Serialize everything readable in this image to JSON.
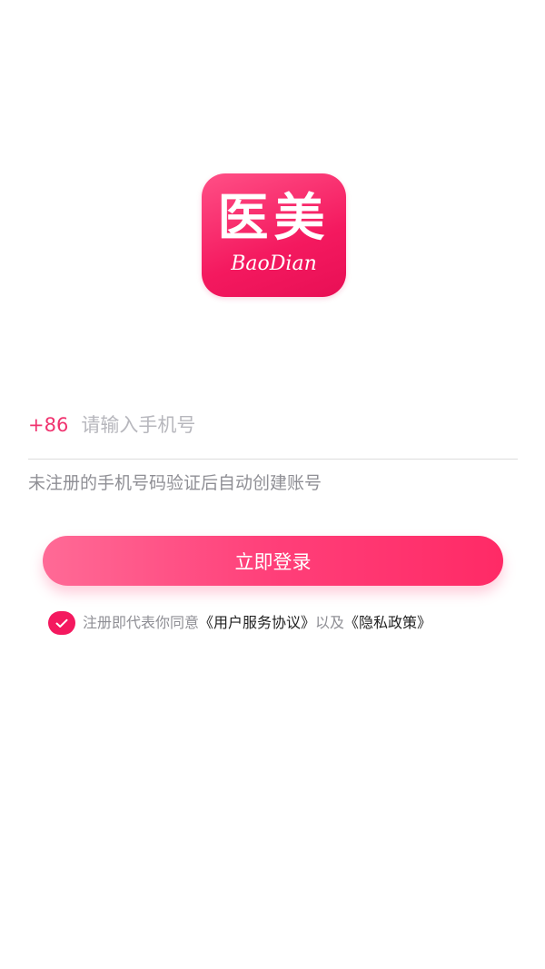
{
  "logo": {
    "main_text": "医美",
    "sub_text": "BaoDian"
  },
  "login": {
    "country_code": "+86",
    "phone_placeholder": "请输入手机号",
    "hint": "未注册的手机号码验证后自动创建账号",
    "button_label": "立即登录"
  },
  "agreement": {
    "prefix": "注册即代表你同意",
    "terms_link": "《用户服务协议》",
    "connector": "以及",
    "privacy_link": "《隐私政策》",
    "checked": true
  },
  "colors": {
    "accent": "#f4195f",
    "country_code": "#f0336f",
    "button_gradient_start": "#ff6a96",
    "button_gradient_end": "#ff2a66",
    "hint_text": "#8f8f95",
    "placeholder": "#b7b7bd"
  },
  "icons": {
    "checkbox": "check-icon"
  }
}
